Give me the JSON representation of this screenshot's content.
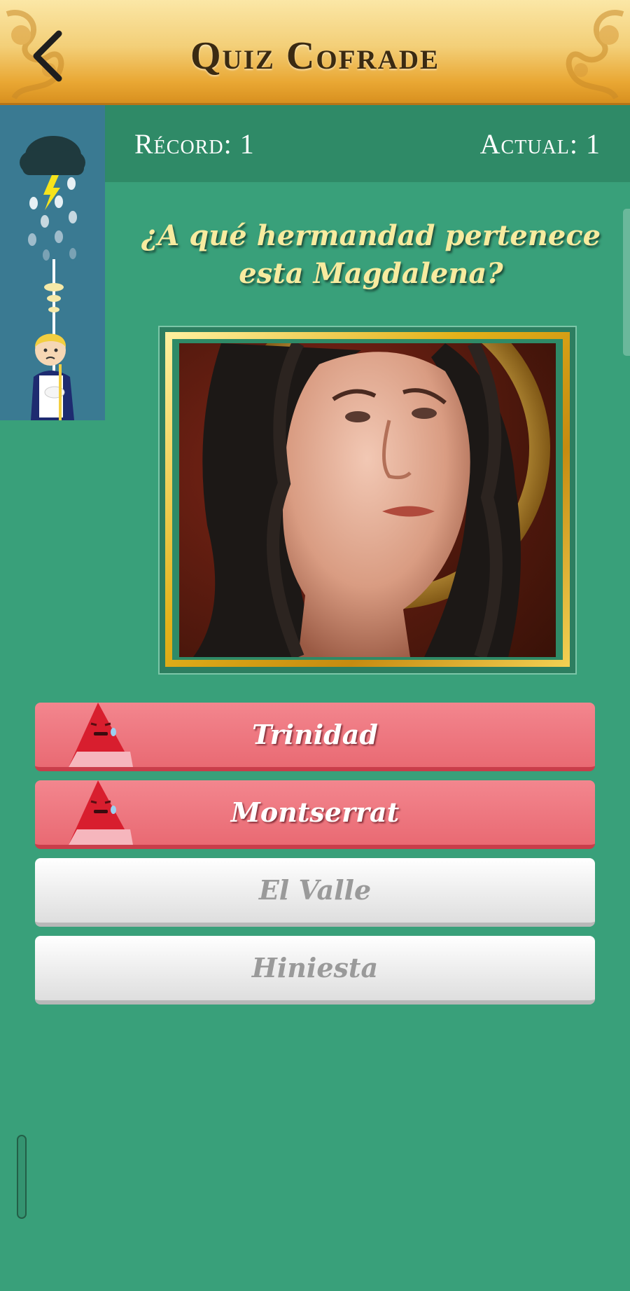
{
  "header": {
    "title": "Quiz Cofrade",
    "back_icon": "chevron-left-icon"
  },
  "score": {
    "record_label": "Récord: 1",
    "current_label": "Actual: 1"
  },
  "question": {
    "text": "¿A qué hermandad pertenece esta Magdalena?"
  },
  "answers": [
    {
      "label": "Trinidad",
      "state": "wrong"
    },
    {
      "label": "Montserrat",
      "state": "wrong"
    },
    {
      "label": "El Valle",
      "state": "neutral"
    },
    {
      "label": "Hiniesta",
      "state": "neutral"
    }
  ],
  "colors": {
    "background": "#39a07a",
    "score_band": "#2f8a67",
    "side_panel": "#3a7a92",
    "wrong_answer": "#ed7079",
    "neutral_answer": "#efefef",
    "question_text": "#f7eb9f"
  },
  "icons": {
    "side_panel_top": "storm-cloud-icon",
    "side_panel_bottom": "cirial-boy-icon",
    "answer_marker": "sad-nazareno-icon"
  }
}
